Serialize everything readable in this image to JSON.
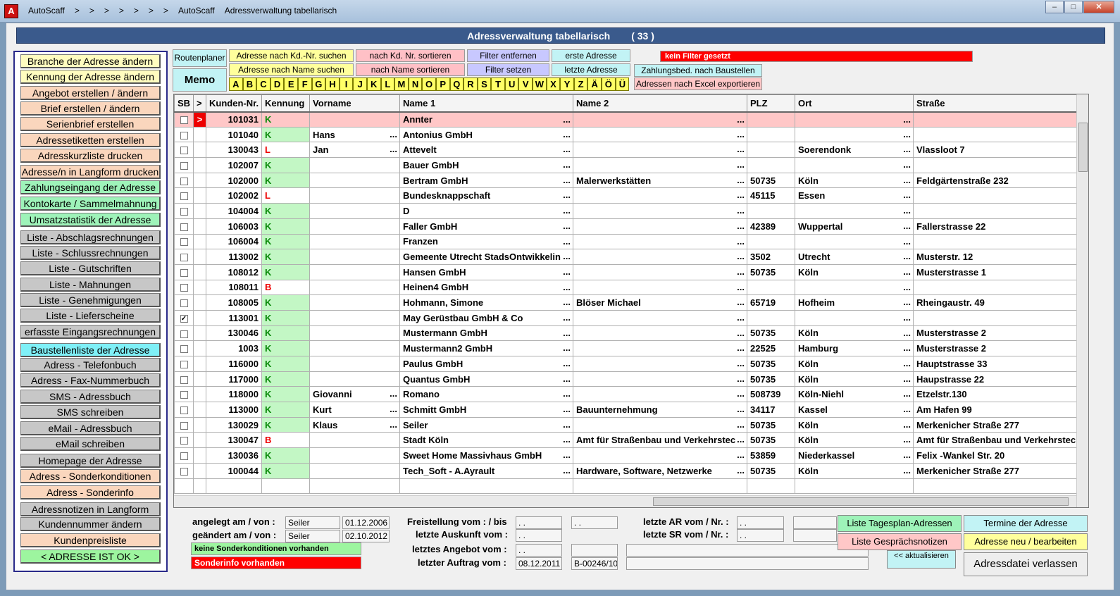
{
  "window": {
    "app_icon_letter": "A",
    "crumbs": [
      "AutoScaff",
      ">",
      ">",
      ">",
      ">",
      ">",
      ">",
      ">",
      "AutoScaff",
      "Adressverwaltung tabellarisch"
    ],
    "btn_min": "‒",
    "btn_max": "□",
    "btn_close": "✕"
  },
  "header": {
    "title": "Adressverwaltung tabellarisch",
    "count": "( 33 )"
  },
  "sidebar": {
    "items": [
      {
        "label": "Branche der Adresse ändern",
        "color": "y"
      },
      {
        "label": "Kennung der Adresse ändern",
        "color": "y"
      },
      {
        "label": "Angebot erstellen / ändern",
        "color": "p"
      },
      {
        "label": "Brief erstellen / ändern",
        "color": "p"
      },
      {
        "label": "Serienbrief erstellen",
        "color": "p"
      },
      {
        "label": "Adressetiketten erstellen",
        "color": "p"
      },
      {
        "label": "Adresskurzliste drucken",
        "color": "p"
      },
      {
        "label": "Adresse/n in Langform drucken",
        "color": "p"
      },
      {
        "label": "Zahlungseingang der Adresse",
        "color": "gr"
      },
      {
        "label": "Kontokarte / Sammelmahnung",
        "color": "gr"
      },
      {
        "label": "Umsatzstatistik der Adresse",
        "color": "gr"
      },
      {
        "label": "Liste - Abschlagsrechnungen",
        "color": "g"
      },
      {
        "label": "Liste - Schlussrechnungen",
        "color": "g"
      },
      {
        "label": "Liste - Gutschriften",
        "color": "g"
      },
      {
        "label": "Liste - Mahnungen",
        "color": "g"
      },
      {
        "label": "Liste - Genehmigungen",
        "color": "g"
      },
      {
        "label": "Liste - Lieferscheine",
        "color": "g"
      },
      {
        "label": "erfasste Eingangsrechnungen",
        "color": "g"
      },
      {
        "label": "Baustellenliste der Adresse",
        "color": "c"
      },
      {
        "label": "Adress - Telefonbuch",
        "color": "g"
      },
      {
        "label": "Adress - Fax-Nummerbuch",
        "color": "g"
      },
      {
        "label": "SMS - Adressbuch",
        "color": "g"
      },
      {
        "label": "SMS schreiben",
        "color": "g"
      },
      {
        "label": "eMail - Adressbuch",
        "color": "g"
      },
      {
        "label": "eMail schreiben",
        "color": "g"
      },
      {
        "label": "Homepage der Adresse",
        "color": "g"
      },
      {
        "label": "Adress - Sonderkonditionen",
        "color": "p"
      },
      {
        "label": "Adress - Sonderinfo",
        "color": "p"
      },
      {
        "label": "Adressnotizen in Langform",
        "color": "g"
      },
      {
        "label": "Kundennummer ändern",
        "color": "g"
      },
      {
        "label": "Kundenpreisliste",
        "color": "p"
      },
      {
        "label": "< ADRESSE IST OK >",
        "color": "lg"
      }
    ]
  },
  "toolbar": {
    "routenplaner": "Routenplaner",
    "memo": "Memo",
    "search_kdnr": "Adresse nach Kd.-Nr. suchen",
    "search_name": "Adresse nach Name suchen",
    "sort_kdnr": "nach Kd. Nr. sortieren",
    "sort_name": "nach Name sortieren",
    "filter_remove": "Filter entfernen",
    "filter_set": "Filter setzen",
    "first": "erste Adresse",
    "last": "letzte Adresse",
    "filter_status": "kein Filter gesetzt",
    "zahlungsbed": "Zahlungsbed. nach Baustellen",
    "excel": "Adressen nach Excel exportieren",
    "letters": [
      "A",
      "B",
      "C",
      "D",
      "E",
      "F",
      "G",
      "H",
      "I",
      "J",
      "K",
      "L",
      "M",
      "N",
      "O",
      "P",
      "Q",
      "R",
      "S",
      "T",
      "U",
      "V",
      "W",
      "X",
      "Y",
      "Z",
      "Ä",
      "Ö",
      "Ü"
    ]
  },
  "table": {
    "columns": [
      "SB",
      ">",
      "Kunden-Nr.",
      "Kennung",
      "Vorname",
      "Name 1",
      "Name 2",
      "PLZ",
      "Ort",
      "Straße"
    ],
    "marker": ">",
    "checkmark": "✓",
    "rows": [
      {
        "sb": false,
        "nr": "101031",
        "k": "K",
        "vor": "",
        "n1": "Annter",
        "n2": "",
        "plz": "",
        "ort": "",
        "str": "",
        "sel": true
      },
      {
        "sb": false,
        "nr": "101040",
        "k": "K",
        "vor": "Hans",
        "n1": "Antonius GmbH",
        "n2": "",
        "plz": "",
        "ort": "",
        "str": ""
      },
      {
        "sb": false,
        "nr": "130043",
        "k": "L",
        "vor": "Jan",
        "n1": "Attevelt",
        "n2": "",
        "plz": "",
        "ort": "Soerendonk",
        "str": "Vlassloot 7"
      },
      {
        "sb": false,
        "nr": "102007",
        "k": "K",
        "vor": "",
        "n1": "Bauer GmbH",
        "n2": "",
        "plz": "",
        "ort": "",
        "str": ""
      },
      {
        "sb": false,
        "nr": "102000",
        "k": "K",
        "vor": "",
        "n1": "Bertram GmbH",
        "n2": "Malerwerkstätten",
        "plz": "50735",
        "ort": "Köln",
        "str": "Feldgärtenstraße 232"
      },
      {
        "sb": false,
        "nr": "102002",
        "k": "L",
        "vor": "",
        "n1": "Bundesknappschaft",
        "n2": "",
        "plz": "45115",
        "ort": "Essen",
        "str": ""
      },
      {
        "sb": false,
        "nr": "104004",
        "k": "K",
        "vor": "",
        "n1": "D",
        "n2": "",
        "plz": "",
        "ort": "",
        "str": ""
      },
      {
        "sb": false,
        "nr": "106003",
        "k": "K",
        "vor": "",
        "n1": "Faller GmbH",
        "n2": "",
        "plz": "42389",
        "ort": "Wuppertal",
        "str": "Fallerstrasse 22"
      },
      {
        "sb": false,
        "nr": "106004",
        "k": "K",
        "vor": "",
        "n1": "Franzen",
        "n2": "",
        "plz": "",
        "ort": "",
        "str": ""
      },
      {
        "sb": false,
        "nr": "113002",
        "k": "K",
        "vor": "",
        "n1": "Gemeente Utrecht StadsOntwikkelin",
        "n2": "",
        "plz": "3502",
        "ort": "Utrecht",
        "str": "Musterstr. 12"
      },
      {
        "sb": false,
        "nr": "108012",
        "k": "K",
        "vor": "",
        "n1": "Hansen GmbH",
        "n2": "",
        "plz": "50735",
        "ort": "Köln",
        "str": "Musterstrasse 1"
      },
      {
        "sb": false,
        "nr": "108011",
        "k": "B",
        "vor": "",
        "n1": "Heinen4 GmbH",
        "n2": "",
        "plz": "",
        "ort": "",
        "str": ""
      },
      {
        "sb": false,
        "nr": "108005",
        "k": "K",
        "vor": "",
        "n1": "Hohmann, Simone",
        "n2": "Blöser Michael",
        "plz": "65719",
        "ort": "Hofheim",
        "str": "Rheingaustr. 49"
      },
      {
        "sb": true,
        "nr": "113001",
        "k": "K",
        "vor": "",
        "n1": "May Gerüstbau GmbH & Co",
        "n2": "",
        "plz": "",
        "ort": "",
        "str": ""
      },
      {
        "sb": false,
        "nr": "130046",
        "k": "K",
        "vor": "",
        "n1": "Mustermann GmbH",
        "n2": "",
        "plz": "50735",
        "ort": "Köln",
        "str": "Musterstrasse 2"
      },
      {
        "sb": false,
        "nr": "1003",
        "k": "K",
        "vor": "",
        "n1": "Mustermann2 GmbH",
        "n2": "",
        "plz": "22525",
        "ort": "Hamburg",
        "str": "Musterstrasse 2"
      },
      {
        "sb": false,
        "nr": "116000",
        "k": "K",
        "vor": "",
        "n1": "Paulus GmbH",
        "n2": "",
        "plz": "50735",
        "ort": "Köln",
        "str": "Hauptstrasse 33"
      },
      {
        "sb": false,
        "nr": "117000",
        "k": "K",
        "vor": "",
        "n1": "Quantus GmbH",
        "n2": "",
        "plz": "50735",
        "ort": "Köln",
        "str": "Haupstrasse 22"
      },
      {
        "sb": false,
        "nr": "118000",
        "k": "K",
        "vor": "Giovanni",
        "n1": "Romano",
        "n2": "",
        "plz": "508739",
        "ort": "Köln-Niehl",
        "str": "Etzelstr.130"
      },
      {
        "sb": false,
        "nr": "113000",
        "k": "K",
        "vor": "Kurt",
        "n1": "Schmitt GmbH",
        "n2": "Bauunternehmung",
        "plz": "34117",
        "ort": "Kassel",
        "str": "Am Hafen 99"
      },
      {
        "sb": false,
        "nr": "130029",
        "k": "K",
        "vor": "Klaus",
        "n1": "Seiler",
        "n2": "",
        "plz": "50735",
        "ort": "Köln",
        "str": "Merkenicher Straße 277"
      },
      {
        "sb": false,
        "nr": "130047",
        "k": "B",
        "vor": "",
        "n1": "Stadt Köln",
        "n2": "Amt für Straßenbau und Verkehrstec",
        "plz": "50735",
        "ort": "Köln",
        "str": "Amt für Straßenbau und Verkehrstec"
      },
      {
        "sb": false,
        "nr": "130036",
        "k": "K",
        "vor": "",
        "n1": "Sweet Home Massivhaus GmbH",
        "n2": "",
        "plz": "53859",
        "ort": "Niederkassel",
        "str": "Felix -Wankel Str. 20"
      },
      {
        "sb": false,
        "nr": "100044",
        "k": "K",
        "vor": "",
        "n1": "Tech_Soft - A.Ayrault",
        "n2": "Hardware, Software, Netzwerke",
        "plz": "50735",
        "ort": "Köln",
        "str": "Merkenicher Straße 277"
      }
    ]
  },
  "footer": {
    "angelegt_label": "angelegt am / von :",
    "angelegt_user": "Seiler",
    "angelegt_date": "01.12.2006",
    "geaendert_label": "geändert am / von :",
    "geaendert_user": "Seiler",
    "geaendert_date": "02.10.2012",
    "sonderkond": "keine Sonderkonditionen vorhanden",
    "sonderinfo": "Sonderinfo vorhanden",
    "freistellung_label": "Freistellung vom : / bis",
    "freistellung_from": ". .",
    "freistellung_to": ". .",
    "auskunft_label": "letzte Auskunft vom :",
    "auskunft_date": ". .",
    "angebot_label": "letztes Angebot vom :",
    "angebot_date": ". .",
    "auftrag_label": "letzter Auftrag vom :",
    "auftrag_date": "08.12.2011",
    "auftrag_nr": "B-00246/10",
    "ar_label": "letzte AR vom / Nr. :",
    "ar_date": ". .",
    "sr_label": "letzte SR vom / Nr. :",
    "sr_date": ". .",
    "btn_tagesplan": "Liste Tagesplan-Adressen",
    "btn_gespraech": "Liste Gesprächsnotizen",
    "btn_termine": "Termine der Adresse",
    "btn_neu": "Adresse neu / bearbeiten",
    "btn_aktualisieren": "<< aktualisieren",
    "btn_verlassen": "Adressdatei verlassen"
  }
}
